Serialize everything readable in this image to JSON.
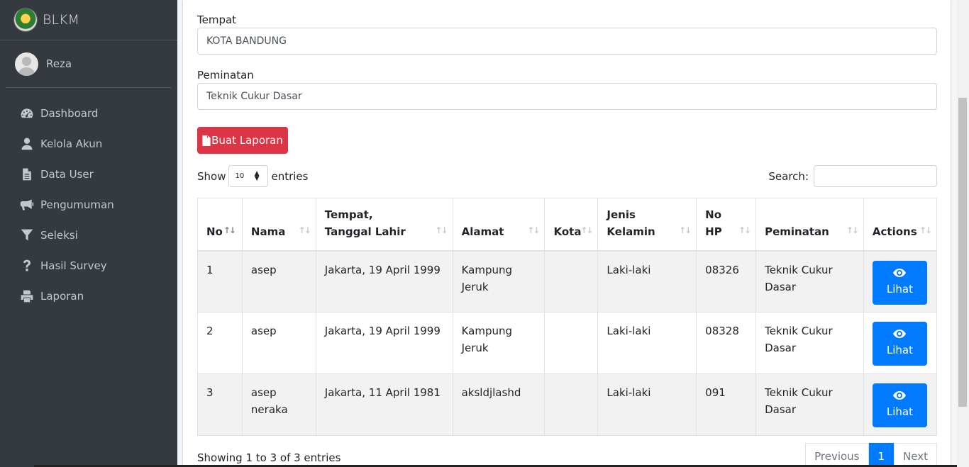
{
  "sidebar": {
    "brand": "BLKM",
    "user": "Reza",
    "items": [
      {
        "label": "Dashboard",
        "icon": "tachometer-icon"
      },
      {
        "label": "Kelola Akun",
        "icon": "user-icon"
      },
      {
        "label": "Data User",
        "icon": "file-icon"
      },
      {
        "label": "Pengumuman",
        "icon": "bullhorn-icon"
      },
      {
        "label": "Seleksi",
        "icon": "filter-icon"
      },
      {
        "label": "Hasil Survey",
        "icon": "question-icon"
      },
      {
        "label": "Laporan",
        "icon": "print-icon"
      }
    ]
  },
  "form": {
    "tempat_label": "Tempat",
    "tempat_value": "KOTA BANDUNG",
    "peminatan_label": "Peminatan",
    "peminatan_value": "Teknik Cukur Dasar",
    "report_button": "Buat Laporan"
  },
  "table_controls": {
    "show": "Show",
    "entries_value": "10",
    "entries": "entries",
    "search_label": "Search:"
  },
  "table": {
    "headers": [
      "No",
      "Nama",
      "Tempat, Tanggal Lahir",
      "Alamat",
      "Kota",
      "Jenis Kelamin",
      "No HP",
      "Peminatan",
      "Actions"
    ],
    "rows": [
      {
        "no": "1",
        "nama": "asep",
        "ttl": "Jakarta, 19 April 1999",
        "alamat": "Kampung Jeruk",
        "kota": "",
        "jk": "Laki-laki",
        "hp": "08326",
        "peminatan": "Teknik Cukur Dasar",
        "action": "Lihat"
      },
      {
        "no": "2",
        "nama": "asep",
        "ttl": "Jakarta, 19 April 1999",
        "alamat": "Kampung Jeruk",
        "kota": "",
        "jk": "Laki-laki",
        "hp": "08328",
        "peminatan": "Teknik Cukur Dasar",
        "action": "Lihat"
      },
      {
        "no": "3",
        "nama": "asep neraka",
        "ttl": "Jakarta, 11 April 1981",
        "alamat": "aksldjlashd",
        "kota": "",
        "jk": "Laki-laki",
        "hp": "091",
        "peminatan": "Teknik Cukur Dasar",
        "action": "Lihat"
      }
    ]
  },
  "footer": {
    "showing": "Showing 1 to 3 of 3 entries",
    "previous": "Previous",
    "page": "1",
    "next": "Next"
  },
  "colors": {
    "sidebar_bg": "#343a40",
    "danger": "#dc3545",
    "primary": "#007bff"
  }
}
